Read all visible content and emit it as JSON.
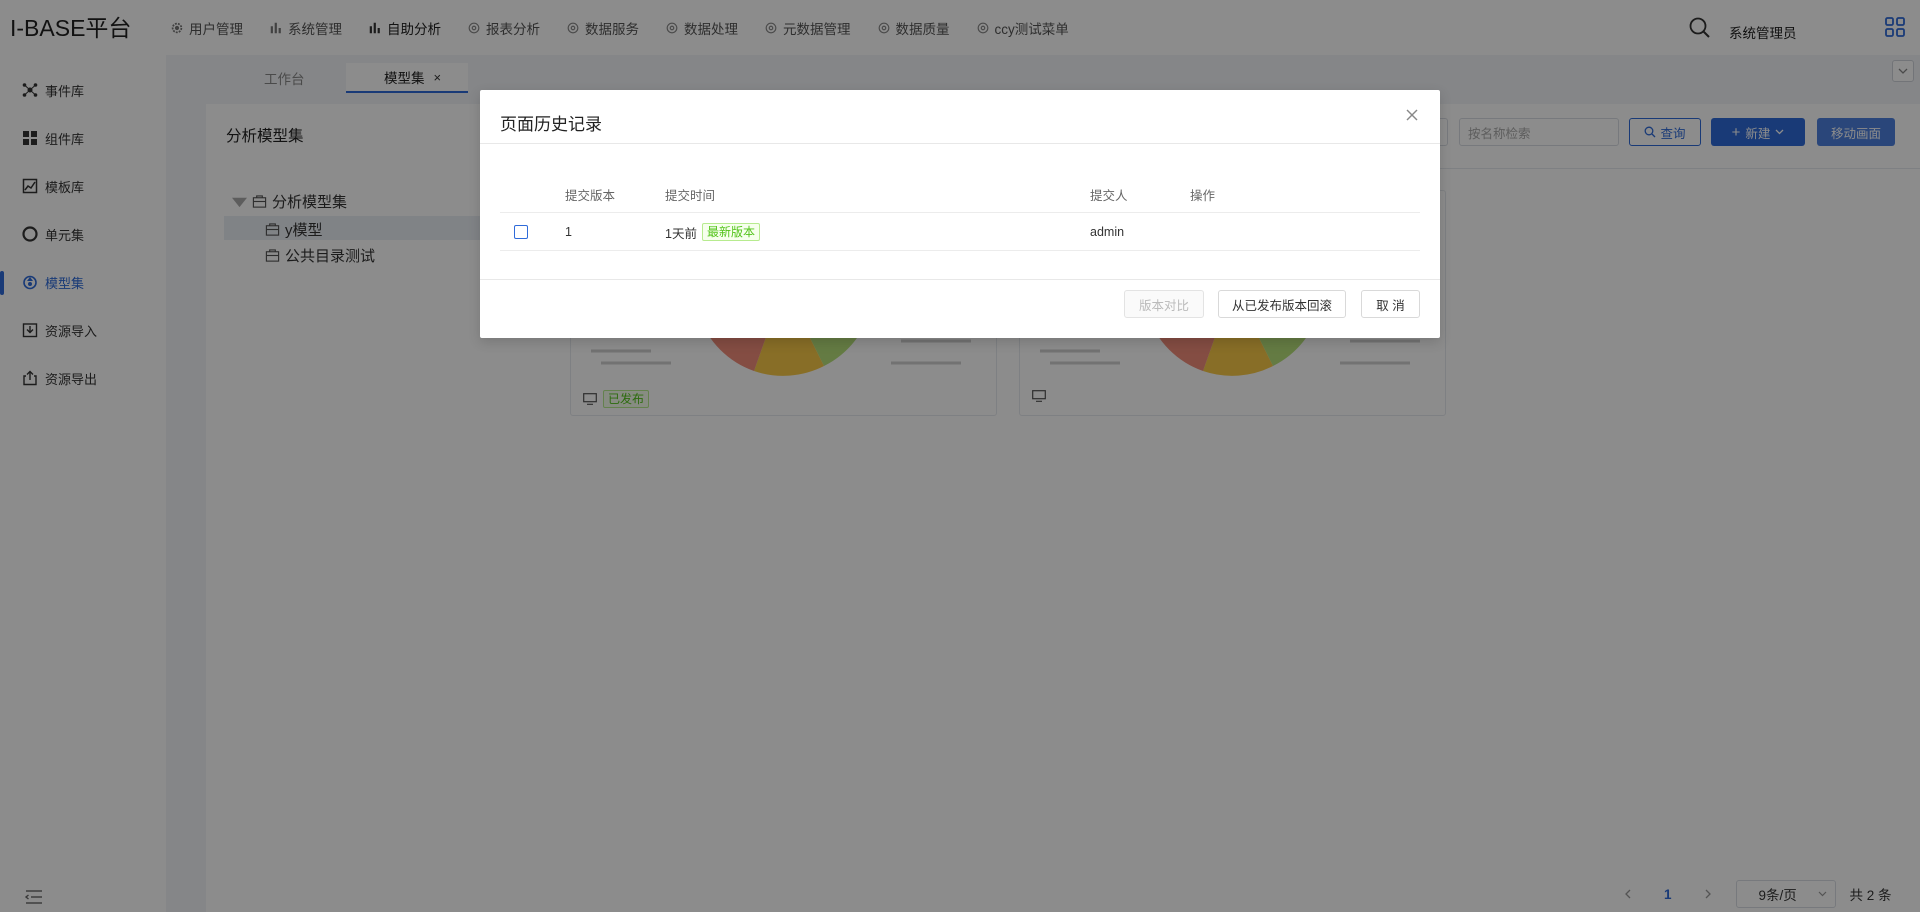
{
  "app": {
    "logo": "I-BASE平台"
  },
  "nav": [
    {
      "label": "用户管理",
      "icon": "gear-icon"
    },
    {
      "label": "系统管理",
      "icon": "bar-chart-icon"
    },
    {
      "label": "自助分析",
      "icon": "bar-chart-icon",
      "active": true
    },
    {
      "label": "报表分析",
      "icon": "gear-icon"
    },
    {
      "label": "数据服务",
      "icon": "gear-icon"
    },
    {
      "label": "数据处理",
      "icon": "gear-icon"
    },
    {
      "label": "元数据管理",
      "icon": "gear-icon"
    },
    {
      "label": "数据质量",
      "icon": "gear-icon"
    },
    {
      "label": "ccy测试菜单",
      "icon": "gear-icon"
    }
  ],
  "header": {
    "user": "系统管理员",
    "search_icon": "search-icon",
    "apps_icon": "apps-grid-icon"
  },
  "sidebar": {
    "items": [
      {
        "label": "事件库",
        "icon": "event-icon"
      },
      {
        "label": "组件库",
        "icon": "component-grid-icon"
      },
      {
        "label": "模板库",
        "icon": "template-icon"
      },
      {
        "label": "单元集",
        "icon": "unit-icon"
      },
      {
        "label": "模型集",
        "icon": "model-icon",
        "active": true
      },
      {
        "label": "资源导入",
        "icon": "import-icon"
      },
      {
        "label": "资源导出",
        "icon": "export-icon"
      }
    ]
  },
  "tabs": {
    "workbench": "工作台",
    "models": "模型集",
    "close": "×"
  },
  "panel": {
    "title": "分析模型集",
    "tree": {
      "root": "分析模型集",
      "children": [
        "y模型",
        "公共目录测试"
      ]
    }
  },
  "toolbar": {
    "search_placeholder": "按名称检索",
    "query_label": "查询",
    "new_label": "新建",
    "move_label": "移动画面"
  },
  "cards": [
    {
      "status": "已发布"
    },
    {
      "status": ""
    }
  ],
  "pagination": {
    "current": "1",
    "page_size": "9条/页",
    "total": "共 2 条"
  },
  "colors": {
    "accent": "#2f6bd9",
    "success": "#52c41a"
  },
  "modal": {
    "title": "页面历史记录",
    "columns": {
      "version": "提交版本",
      "time": "提交时间",
      "user": "提交人",
      "op": "操作"
    },
    "rows": [
      {
        "version": "1",
        "time": "1天前",
        "tag": "最新版本",
        "user": "admin",
        "op": ""
      }
    ],
    "buttons": {
      "compare": "版本对比",
      "rollback": "从已发布版本回滚",
      "cancel": "取 消"
    }
  }
}
